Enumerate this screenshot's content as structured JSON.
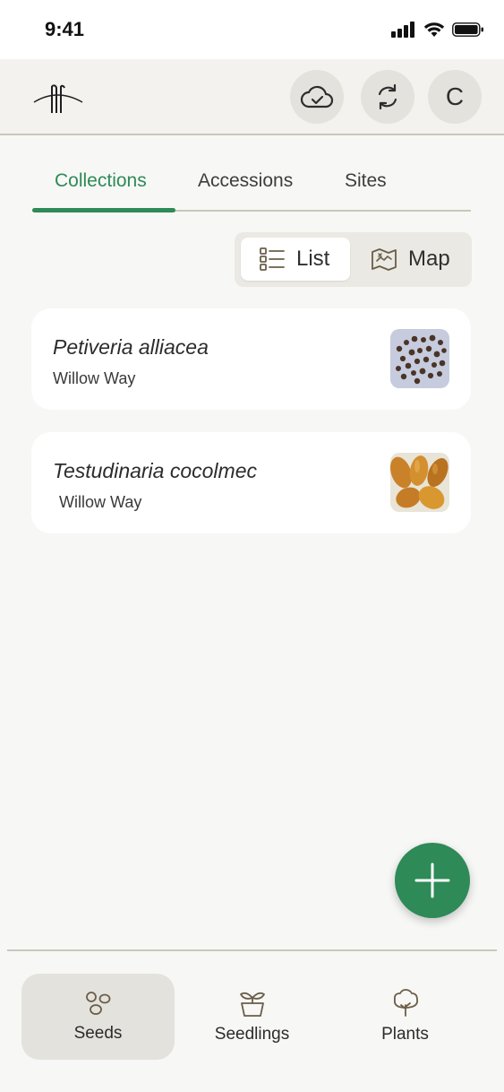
{
  "status_bar": {
    "time": "9:41"
  },
  "header": {
    "avatar_initial": "C"
  },
  "tabs": [
    {
      "label": "Collections",
      "active": true
    },
    {
      "label": "Accessions",
      "active": false
    },
    {
      "label": "Sites",
      "active": false
    }
  ],
  "view_toggle": {
    "list_label": "List",
    "map_label": "Map",
    "selected": "List"
  },
  "collections": [
    {
      "species": "Petiveria alliacea",
      "site": "Willow Way",
      "thumb": "seed-photo-dark-seeds"
    },
    {
      "species": "Testudinaria cocolmec",
      "site": "Willow Way",
      "thumb": "seed-photo-orange-seeds"
    }
  ],
  "bottom_nav": [
    {
      "label": "Seeds",
      "icon": "seeds-icon",
      "active": true
    },
    {
      "label": "Seedlings",
      "icon": "seedling-pot-icon",
      "active": false
    },
    {
      "label": "Plants",
      "icon": "tree-icon",
      "active": false
    }
  ],
  "colors": {
    "accent": "#2e8a57",
    "divider": "#c9c8b8",
    "chip": "#e4e2dc"
  }
}
